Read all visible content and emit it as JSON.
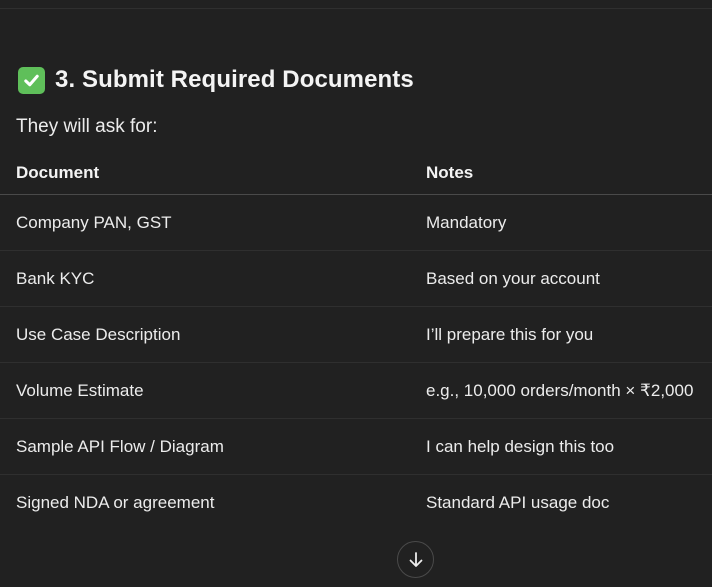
{
  "section": {
    "icon": "check-mark-button-icon",
    "heading": "3. Submit Required Documents",
    "intro": "They will ask for:"
  },
  "table": {
    "headers": [
      "Document",
      "Notes"
    ],
    "rows": [
      {
        "document": "Company PAN, GST",
        "notes": "Mandatory"
      },
      {
        "document": "Bank KYC",
        "notes": "Based on your account"
      },
      {
        "document": "Use Case Description",
        "notes": "I’ll prepare this for you"
      },
      {
        "document": "Volume Estimate",
        "notes": "e.g., 10,000 orders/month × ₹2,000"
      },
      {
        "document": "Sample API Flow / Diagram",
        "notes": "I can help design this too"
      },
      {
        "document": "Signed NDA or agreement",
        "notes": "Standard API usage doc"
      }
    ]
  },
  "scroll_button": {
    "icon": "arrow-down-icon"
  },
  "colors": {
    "background": "#212121",
    "text": "#ececec",
    "check_green": "#5fbf5a"
  }
}
